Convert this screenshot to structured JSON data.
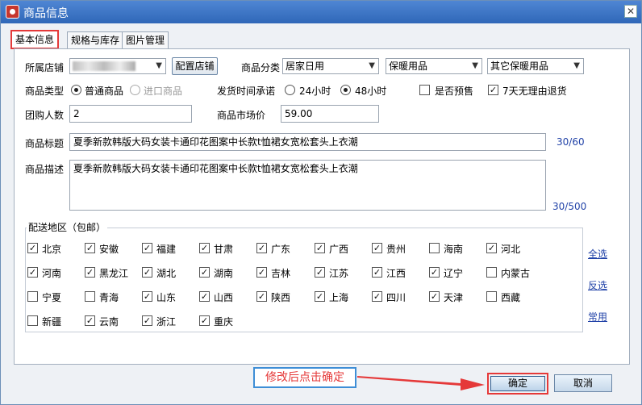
{
  "window": {
    "title": "商品信息",
    "close_glyph": "✕"
  },
  "tabs": [
    {
      "label": "基本信息",
      "active": true
    },
    {
      "label": "规格与库存",
      "active": false
    },
    {
      "label": "图片管理",
      "active": false
    }
  ],
  "form": {
    "shop_label": "所属店铺",
    "shop_button": "配置店铺",
    "category_label": "商品分类",
    "category_1": "居家日用",
    "category_2": "保暖用品",
    "category_3": "其它保暖用品",
    "type_label": "商品类型",
    "type_normal": "普通商品",
    "type_import": "进口商品",
    "ship_label": "发货时间承诺",
    "ship_24": "24小时",
    "ship_48": "48小时",
    "presale_label": "是否预售",
    "return_label": "7天无理由退货",
    "group_label": "团购人数",
    "group_value": "2",
    "market_label": "商品市场价",
    "market_value": "59.00",
    "title_label": "商品标题",
    "title_value": "夏季新款韩版大码女装卡通印花图案中长款t恤裙女宽松套头上衣潮",
    "title_counter": "30/60",
    "desc_label": "商品描述",
    "desc_value": "夏季新款韩版大码女装卡通印花图案中长款t恤裙女宽松套头上衣潮",
    "desc_counter": "30/500"
  },
  "delivery": {
    "title": "配送地区（包邮）",
    "regions": [
      {
        "name": "北京",
        "checked": true
      },
      {
        "name": "安徽",
        "checked": true
      },
      {
        "name": "福建",
        "checked": true
      },
      {
        "name": "甘肃",
        "checked": true
      },
      {
        "name": "广东",
        "checked": true
      },
      {
        "name": "广西",
        "checked": true
      },
      {
        "name": "贵州",
        "checked": true
      },
      {
        "name": "海南",
        "checked": false
      },
      {
        "name": "河北",
        "checked": true
      },
      {
        "name": "河南",
        "checked": true
      },
      {
        "name": "黑龙江",
        "checked": true
      },
      {
        "name": "湖北",
        "checked": true
      },
      {
        "name": "湖南",
        "checked": true
      },
      {
        "name": "吉林",
        "checked": true
      },
      {
        "name": "江苏",
        "checked": true
      },
      {
        "name": "江西",
        "checked": true
      },
      {
        "name": "辽宁",
        "checked": true
      },
      {
        "name": "内蒙古",
        "checked": false
      },
      {
        "name": "宁夏",
        "checked": false
      },
      {
        "name": "青海",
        "checked": false
      },
      {
        "name": "山东",
        "checked": true
      },
      {
        "name": "山西",
        "checked": true
      },
      {
        "name": "陕西",
        "checked": true
      },
      {
        "name": "上海",
        "checked": true
      },
      {
        "name": "四川",
        "checked": true
      },
      {
        "name": "天津",
        "checked": true
      },
      {
        "name": "西藏",
        "checked": false
      },
      {
        "name": "新疆",
        "checked": false
      },
      {
        "name": "云南",
        "checked": true
      },
      {
        "name": "浙江",
        "checked": true
      },
      {
        "name": "重庆",
        "checked": true
      }
    ],
    "select_all": "全选",
    "invert": "反选",
    "common": "常用"
  },
  "annotation": "修改后点击确定",
  "buttons": {
    "ok": "确定",
    "cancel": "取消"
  },
  "colors": {
    "highlight": "#e53939",
    "link": "#2243a8",
    "callout_border": "#3e8ed6"
  }
}
